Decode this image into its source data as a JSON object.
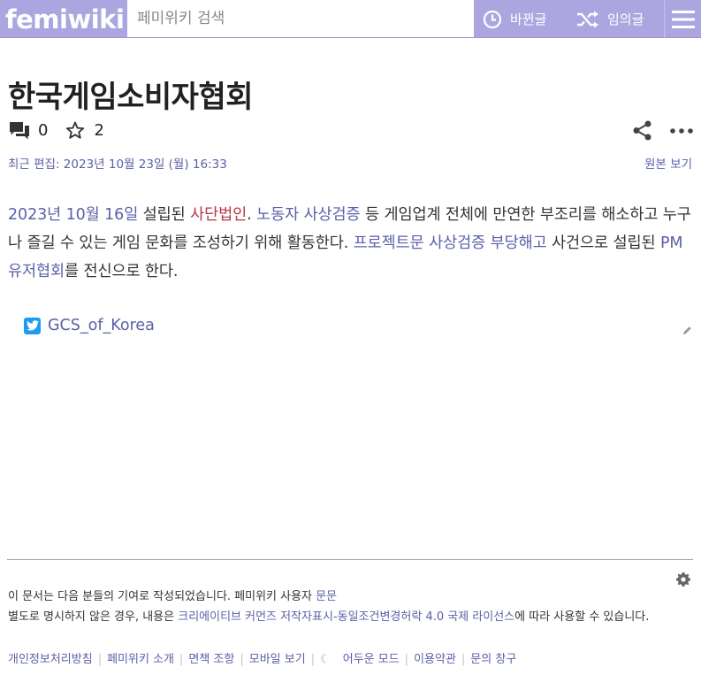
{
  "header": {
    "logo": "femiwiki",
    "search_placeholder": "페미위키 검색",
    "recent_label": "바뀐글",
    "random_label": "임의글"
  },
  "page": {
    "title": "한국게임소비자협회",
    "talk_count": "0",
    "watch_count": "2",
    "last_edited": "최근 편집: 2023년 10월 23일 (월) 16:33",
    "view_source": "원본 보기"
  },
  "content": {
    "p1": "2023년 10월 16일",
    "p2": " 설립된 ",
    "p3": "사단법인",
    "p4": ". ",
    "p5": "노동자 사상검증",
    "p6": " 등 게임업계 전체에 만연한 부조리를 해소하고 누구나 즐길 수 있는 게임 문화를 조성하기 위해 활동한다. ",
    "p7": "프로젝트문 사상검증 부당해고",
    "p8": " 사건으로 설립된 ",
    "p9": "PM유저협회",
    "p10": "를 전신으로 한다.",
    "twitter_handle": "GCS_of_Korea"
  },
  "footer": {
    "contrib_text": "이 문서는 다음 분들의 기여로 작성되었습니다. 페미위키 사용자 ",
    "contrib_user": "문문",
    "license_pre": "별도로 명시하지 않은 경우, 내용은 ",
    "license_link": "크리에이티브 커먼즈 저작자표시-동일조건변경허락 4.0 국제 라이선스",
    "license_post": "에 따라 사용할 수 있습니다.",
    "links": [
      "개인정보처리방침",
      "페미위키 소개",
      "면책 조항",
      "모바일 보기"
    ],
    "dark_mode": "어두운 모드",
    "links2": [
      "이용약관",
      "문의 창구"
    ]
  },
  "colors": {
    "header_bg": "#aca6e0",
    "link": "#5b5fa8",
    "new_link": "#b53648",
    "twitter": "#1d9bf0"
  }
}
